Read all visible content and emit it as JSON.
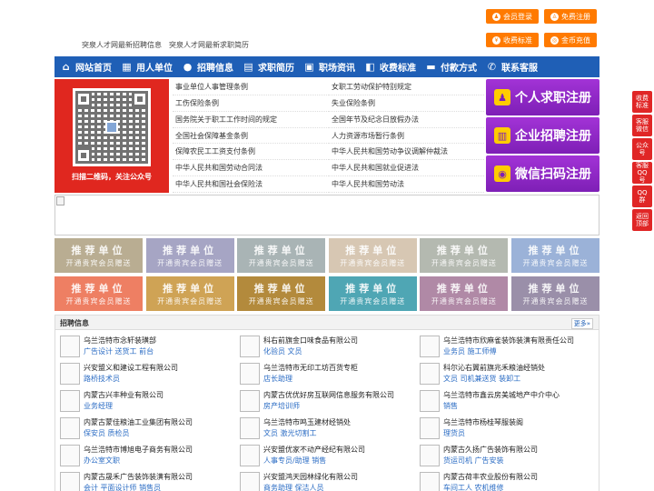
{
  "header": {
    "links": [
      "突泉人才网最新招聘信息",
      "突泉人才网最新求职简历"
    ],
    "buttons": [
      {
        "label": "会员登录",
        "icon": "user-icon"
      },
      {
        "label": "免费注册",
        "icon": "person-add-icon"
      },
      {
        "label": "收费标准",
        "icon": "yen-icon"
      },
      {
        "label": "金币充值",
        "icon": "coin-icon"
      }
    ]
  },
  "nav": [
    {
      "label": "网站首页",
      "icon": "home-icon",
      "glyph": "⌂"
    },
    {
      "label": "用人单位",
      "icon": "building-icon",
      "glyph": "▦"
    },
    {
      "label": "招聘信息",
      "icon": "chat-icon",
      "glyph": "●"
    },
    {
      "label": "求职简历",
      "icon": "resume-icon",
      "glyph": "▤"
    },
    {
      "label": "职场资讯",
      "icon": "news-icon",
      "glyph": "▣"
    },
    {
      "label": "收费标准",
      "icon": "tag-icon",
      "glyph": "◧"
    },
    {
      "label": "付款方式",
      "icon": "card-icon",
      "glyph": "▬"
    },
    {
      "label": "联系客服",
      "icon": "phone-icon",
      "glyph": "✆"
    }
  ],
  "qr": {
    "caption": "扫描二维码，关注公众号"
  },
  "laws": [
    "事业单位人事管理条例",
    "女职工劳动保护特别规定",
    "工伤保险条例",
    "失业保险条例",
    "国务院关于职工工作时间的规定",
    "全国年节及纪念日放假办法",
    "全国社会保障基金条例",
    "人力资源市场暂行条例",
    "保障农民工工资支付条例",
    "中华人民共和国劳动争议调解仲裁法",
    "中华人民共和国劳动合同法",
    "中华人民共和国就业促进法",
    "中华人民共和国社会保险法",
    "中华人民共和国劳动法"
  ],
  "register": [
    {
      "label": "个人求职注册",
      "icon": "person-icon",
      "glyph": "♟"
    },
    {
      "label": "企业招聘注册",
      "icon": "company-icon",
      "glyph": "▥"
    },
    {
      "label": "微信扫码注册",
      "icon": "wechat-icon",
      "glyph": "◉"
    }
  ],
  "recommend": {
    "title": "推荐单位",
    "subtitle": "开通贵宾会员赠送",
    "colors": [
      "#b9ad92",
      "#a6a5c4",
      "#a9b4b5",
      "#d7c7b3",
      "#b4b9b0",
      "#9bb2d8",
      "#ee7f63",
      "#cfa355",
      "#b38a3c",
      "#4fa6b4",
      "#b089a6",
      "#9a8fa9"
    ]
  },
  "jobs": {
    "title": "招聘信息",
    "more": "更多»",
    "items": [
      {
        "company": "乌兰浩特市念轩装璜部",
        "positions": "广告设计 送货工 前台"
      },
      {
        "company": "科右前旗金口味食品有限公司",
        "positions": "化验员 文员"
      },
      {
        "company": "乌兰浩特市欣麻雀装饰装潢有限责任公司",
        "positions": "业务员 施工师傅"
      },
      {
        "company": "兴安盟义和建设工程有限公司",
        "positions": "路桥技术员"
      },
      {
        "company": "乌兰浩特市无印工坊百货专柜",
        "positions": "店长助理"
      },
      {
        "company": "科尔沁右翼前旗兆禾粮油经销处",
        "positions": "文员 司机兼送货 装卸工"
      },
      {
        "company": "内蒙古兴丰种业有限公司",
        "positions": "业务经理"
      },
      {
        "company": "内蒙古优优好房互联网信息服务有限公司",
        "positions": "房产培训师"
      },
      {
        "company": "乌兰浩特市鑫云房美城地产中介中心",
        "positions": "销售"
      },
      {
        "company": "内蒙古蒙佳粮油工业集团有限公司",
        "positions": "保安员 质检员"
      },
      {
        "company": "乌兰浩特市鸣玉建材经销处",
        "positions": "文员 激光切割工"
      },
      {
        "company": "乌兰浩特市杨桂琴服装阁",
        "positions": "理货员"
      },
      {
        "company": "乌兰浩特市博旭电子商务有限公司",
        "positions": "办公室文职"
      },
      {
        "company": "兴安盟优家不动产经纪有限公司",
        "positions": "人事专员/助理 销售"
      },
      {
        "company": "内蒙古久扬广告装饰有限公司",
        "positions": "货运司机 广告安装"
      },
      {
        "company": "内蒙古晟禾广告装饰装潢有限公司",
        "positions": "会计 平面设计师 销售员"
      },
      {
        "company": "兴安盟鸿天园林绿化有限公司",
        "positions": "商务助理 保洁人员"
      },
      {
        "company": "内蒙古荷丰农业股份有限公司",
        "positions": "车间工人 农机维修"
      }
    ]
  },
  "float_bar": [
    "收费标准",
    "客服微信",
    "公众号",
    "客服QQ号",
    "QQ群",
    "返回顶部"
  ]
}
